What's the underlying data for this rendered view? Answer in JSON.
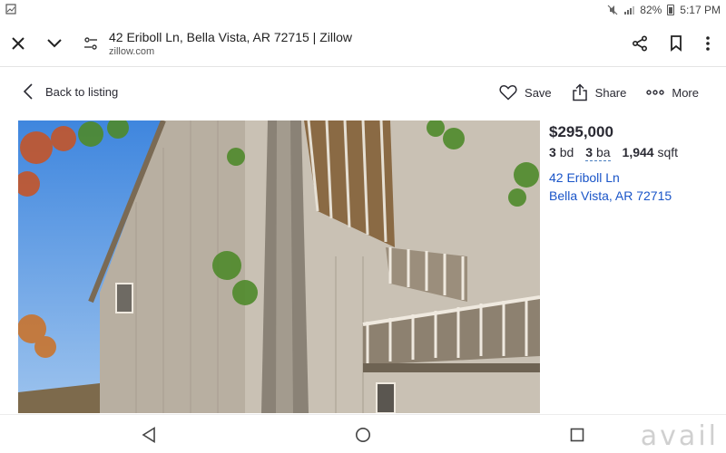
{
  "status_bar": {
    "battery": "82%",
    "time": "5:17 PM"
  },
  "browser": {
    "page_title": "42 Eriboll Ln, Bella Vista, AR 72715 | Zillow",
    "host": "zillow.com"
  },
  "listing_bar": {
    "back_label": "Back to listing",
    "save_label": "Save",
    "share_label": "Share",
    "more_label": "More"
  },
  "listing": {
    "price": "$295,000",
    "beds_value": "3",
    "beds_unit": "bd",
    "baths_value": "3",
    "baths_unit": "ba",
    "sqft_value": "1,944",
    "sqft_unit": "sqft",
    "street": "42 Eriboll Ln",
    "city_state_zip": "Bella Vista, AR 72715"
  },
  "watermark": "avail",
  "colors": {
    "link": "#1a55c8",
    "sky": "#4a8fe0",
    "siding": "#c9c1b4"
  }
}
